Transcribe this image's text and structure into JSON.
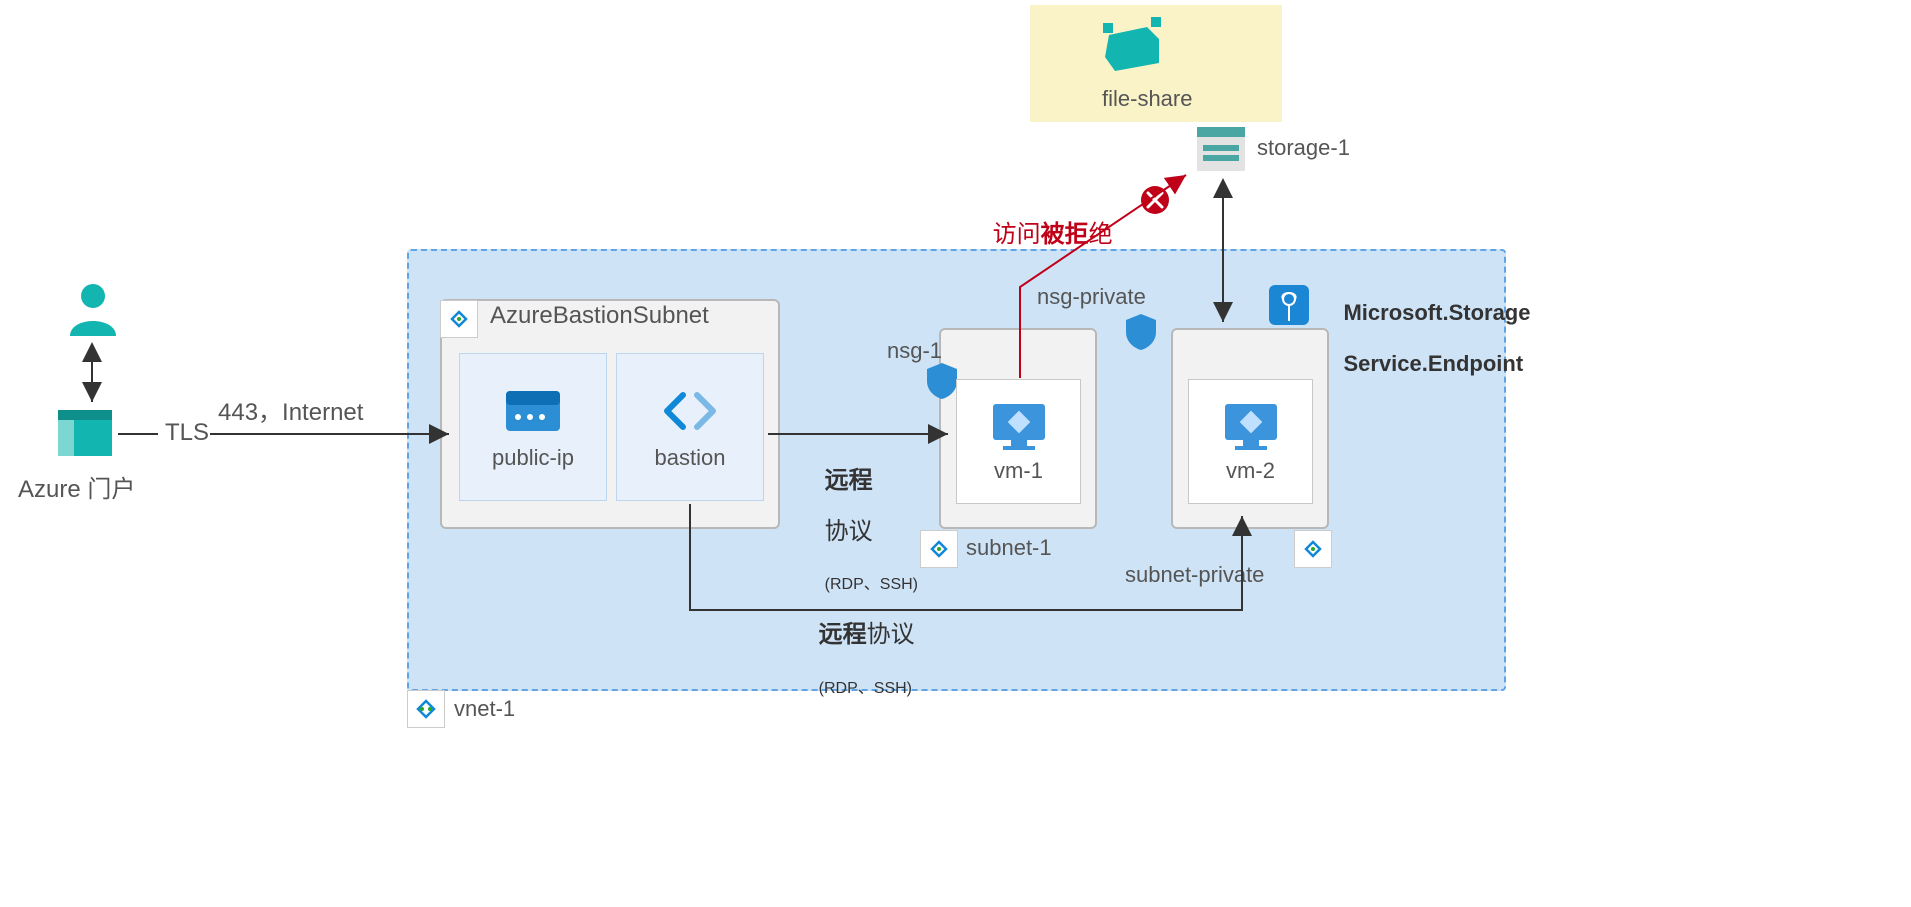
{
  "labels": {
    "azure_portal": "Azure 门户",
    "tls": "TLS",
    "internet": "443，Internet",
    "vnet": "vnet-1",
    "bastion_subnet": "AzureBastionSubnet",
    "public_ip": "public-ip",
    "bastion": "bastion",
    "remote1_line1": "远程",
    "remote1_line2": "协议",
    "remote1_sub": "(RDP、SSH)",
    "remote2_line1": "远程协议",
    "remote2_sub": "(RDP、SSH)",
    "nsg1": "nsg-1",
    "vm1": "vm-1",
    "subnet1": "subnet-1",
    "nsg_private": "nsg-private",
    "vm2": "vm-2",
    "subnet_private": "subnet-private",
    "storage": "storage-1",
    "fileshare": "file-share",
    "service_endpoint_line1": "Microsoft.Storage",
    "service_endpoint_line2": "Service.Endpoint",
    "access_denied_pre": "访问",
    "access_denied_mid": "被拒",
    "access_denied_post": "绝"
  },
  "colors": {
    "azure_blue": "#0f88d8",
    "teal": "#13b5b1",
    "red": "#c00018",
    "gray": "#7a7a7a"
  }
}
